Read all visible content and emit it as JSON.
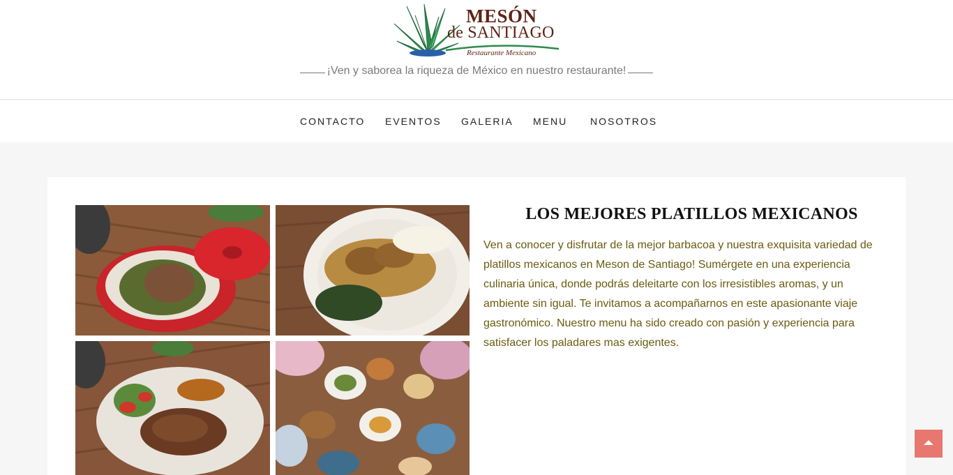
{
  "header": {
    "logo": {
      "line1": "MESÓN",
      "line2": "de SANTIAGO",
      "subtitle": "Restaurante Mexicano",
      "icon": "agave-icon"
    },
    "tagline": "¡Ven y saborea la riqueza de México en nuestro restaurante!"
  },
  "nav": {
    "items": [
      {
        "label": "CONTACTO"
      },
      {
        "label": "EVENTOS"
      },
      {
        "label": "GALERIA"
      },
      {
        "label": "MENU"
      },
      {
        "label": "NOSOTROS"
      }
    ]
  },
  "main": {
    "title": "LOS MEJORES PLATILLOS MEXICANOS",
    "description": "Ven a conocer y disfrutar de la mejor barbacoa y nuestra exquisita variedad de platillos mexicanos en Meson de Santiago! Sumérgete en una experiencia culinaria única, donde podrás deleitarte con los irresistibles aromas, y un ambiente sin igual. Te invitamos a acompañarnos en este apasionante viaje gastronómico. Nuestro menu ha sido creado con pasión y experiencia para satisfacer los paladares mas exigentes.",
    "gallery": [
      {
        "subject": "barbacoa-pot-photo"
      },
      {
        "subject": "mole-plate-photo"
      },
      {
        "subject": "steak-plate-photo"
      },
      {
        "subject": "table-spread-photo"
      }
    ]
  },
  "scroll_top": {
    "icon": "arrow-up-icon",
    "color": "#e8776f"
  },
  "colors": {
    "accent_text": "#6b5a10",
    "logo_brown": "#5c2416",
    "page_bg": "#f6f6f6"
  }
}
